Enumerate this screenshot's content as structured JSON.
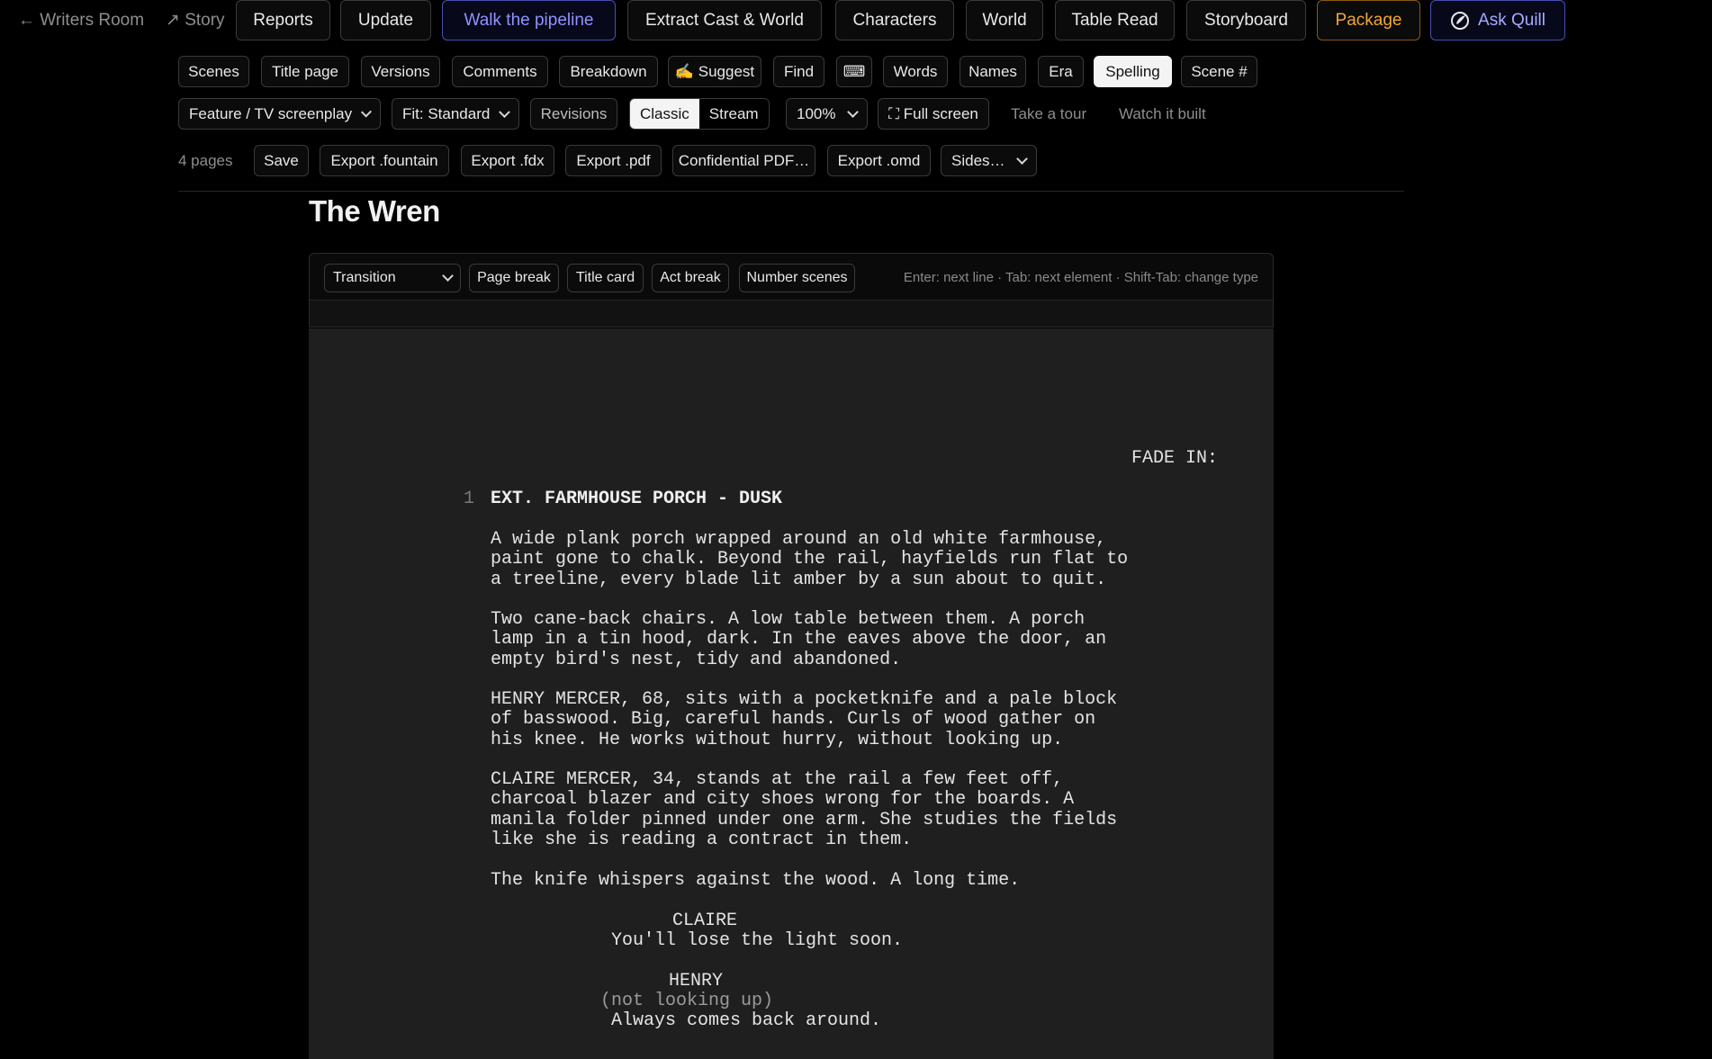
{
  "nav": {
    "back": "← Writers Room",
    "story": "↗ Story",
    "reports": "Reports",
    "update": "Update",
    "pipeline": "Walk the pipeline",
    "extract": "Extract Cast & World",
    "characters": "Characters",
    "world": "World",
    "table_read": "Table Read",
    "storyboard": "Storyboard",
    "package": "Package",
    "ask_quill": "Ask Quill"
  },
  "tools": [
    "Scenes",
    "Title page",
    "Versions",
    "Comments",
    "Breakdown",
    "✍ Suggest",
    "Find",
    "⌨",
    "Words",
    "Names",
    "Era",
    "Spelling",
    "Scene #"
  ],
  "tools_active": "Spelling",
  "settings": {
    "format": "Feature / TV screenplay",
    "fit": "Fit: Standard",
    "revisions": "Revisions",
    "view_classic": "Classic",
    "view_stream": "Stream",
    "zoom": "100%",
    "fullscreen": "⛶ Full screen",
    "tour": "Take a tour",
    "watch": "Watch it built"
  },
  "export": {
    "pages": "4 pages",
    "save": "Save",
    "fountain": "Export .fountain",
    "fdx": "Export .fdx",
    "pdf": "Export .pdf",
    "confidential": "Confidential PDF…",
    "omd": "Export .omd",
    "sides": "Sides…"
  },
  "document": {
    "title": "The Wren"
  },
  "editor": {
    "element_type": "Transition",
    "page_break": "Page break",
    "title_card": "Title card",
    "act_break": "Act break",
    "number_scenes": "Number scenes",
    "hint": "Enter: next line · Tab: next element · Shift-Tab: change type"
  },
  "script": {
    "transition": "FADE IN:",
    "scene_number": "1",
    "scene_heading": "EXT. FARMHOUSE PORCH - DUSK",
    "action1": "A wide plank porch wrapped around an old white farmhouse,\npaint gone to chalk. Beyond the rail, hayfields run flat to\na treeline, every blade lit amber by a sun about to quit.",
    "action2": "Two cane-back chairs. A low table between them. A porch\nlamp in a tin hood, dark. In the eaves above the door, an\nempty bird's nest, tidy and abandoned.",
    "action3": "HENRY MERCER, 68, sits with a pocketknife and a pale block\nof basswood. Big, careful hands. Curls of wood gather on\nhis knee. He works without hurry, without looking up.",
    "action4": "CLAIRE MERCER, 34, stands at the rail a few feet off,\ncharcoal blazer and city shoes wrong for the boards. A\nmanila folder pinned under one arm. She studies the fields\nlike she is reading a contract in them.",
    "action5": "The knife whispers against the wood. A long time.",
    "char1": "CLAIRE",
    "dialogue1": "You'll lose the light soon.",
    "char2": "HENRY",
    "paren2": "(not looking up)",
    "dialogue2": "Always comes back around."
  }
}
